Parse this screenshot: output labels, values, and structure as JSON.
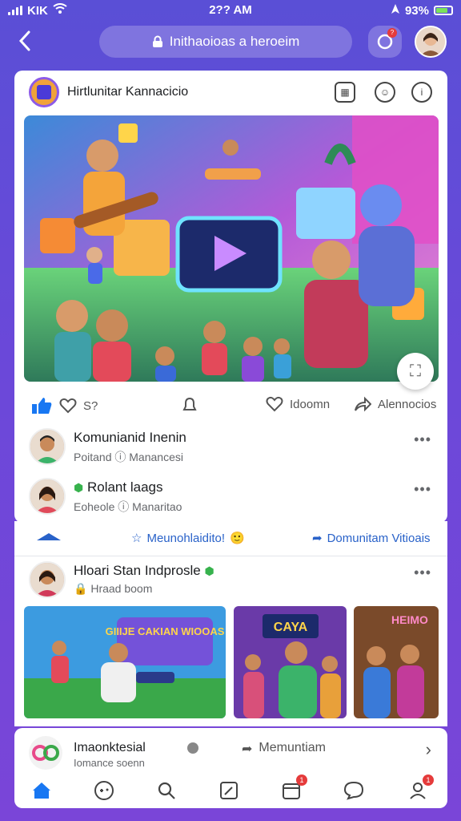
{
  "status_bar": {
    "carrier": "KIK",
    "time": "2?? AM",
    "battery_pct": "93%"
  },
  "top_nav": {
    "address": "Inithaoioas a heroeim",
    "notification_count": "?"
  },
  "post": {
    "page_name": "Hirtlunitar Kannacicio",
    "actions": {
      "likes": "S?",
      "comment_label": "Idoomn",
      "share_label": "Alennocios"
    },
    "comments": [
      {
        "name": "Komunianid Inenin",
        "sub": "Poitand ⓘ Manancesi"
      },
      {
        "name": "Rolant laags",
        "sub": "Eoheole ⓘ Manaritao"
      }
    ]
  },
  "post2": {
    "link_left": "Meunohlaidito!",
    "link_right": "Domunitam Vitioais",
    "author_name": "Hloari Stan Indprosle",
    "author_sub": "Hraad boom",
    "thumbs": [
      {
        "label": "GIIIJE CAKIAN WIOOAS"
      },
      {
        "label": "CAYA"
      },
      {
        "label": "HEIMO"
      }
    ]
  },
  "post3": {
    "name": "Imaonktesial",
    "sub": "Iomance soenn",
    "action": "Memuntiam"
  },
  "tabbar": {
    "items": [
      "home",
      "games",
      "search",
      "edit",
      "calendar",
      "chat",
      "profile"
    ],
    "badge_calendar": "1",
    "badge_profile": "1"
  }
}
